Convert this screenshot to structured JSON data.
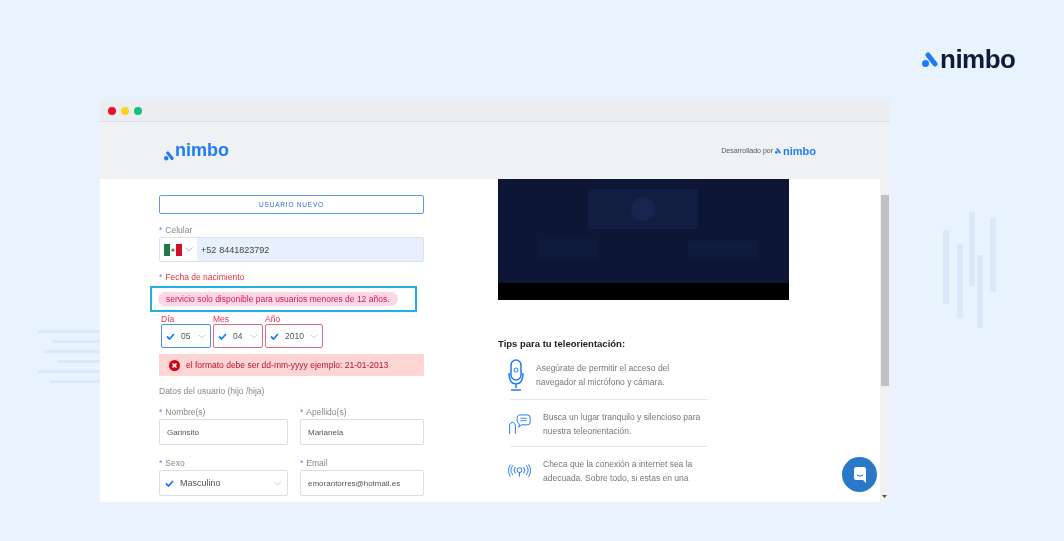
{
  "brand": {
    "logo": "nimbo"
  },
  "header": {
    "logo": "nimbo",
    "credit_label": "Desarrollado por",
    "credit_logo": "nimbo"
  },
  "form": {
    "new_user_button": "USUARIO NUEVO",
    "phone": {
      "mark": "*",
      "label": "Celular",
      "prefix": "+52",
      "value": "8441823792"
    },
    "birth": {
      "mark": "*",
      "label": "Fecha de nacimiento",
      "error": true,
      "notice": "servicio solo disponible para usuarios menores de 12 años.",
      "highlighted": true,
      "selects": [
        {
          "label": "Día",
          "value": "05",
          "checked": true,
          "focused": true,
          "invalid": false
        },
        {
          "label": "Mes",
          "value": "04",
          "checked": true,
          "focused": false,
          "invalid": true
        },
        {
          "label": "Año",
          "value": "2010",
          "checked": true,
          "focused": false,
          "invalid": true
        }
      ],
      "alert": "el formato debe ser dd-mm-yyyy ejemplo: 21-01-2013"
    },
    "section_title": "Datos del usuario (hijo /hija)",
    "fields": [
      {
        "kind": "text",
        "mark": "*",
        "label": "Nombre(s)",
        "value": "Garinsito"
      },
      {
        "kind": "text",
        "mark": "*",
        "label": "Apellido(s)",
        "value": "Marianela"
      },
      {
        "kind": "select",
        "mark": "*",
        "label": "Sexo",
        "value": "Masculino",
        "checked": true
      },
      {
        "kind": "text",
        "mark": "*",
        "label": "Email",
        "value": "emorantorres@hotmail.es"
      }
    ]
  },
  "tips": {
    "title": "Tips para tu teleorientación:",
    "items": [
      {
        "kind": "microphone",
        "text": "Asegúrate de permitir el acceso del navegador al micrófono y cámara."
      },
      {
        "kind": "speech",
        "text": "Busca un lugar tranquilo y silencioso para nuestra teleorientación."
      },
      {
        "kind": "signal",
        "text": "Checa que la conexión a internet sea la adecuada. Sobre todo, si estas en una"
      }
    ]
  }
}
